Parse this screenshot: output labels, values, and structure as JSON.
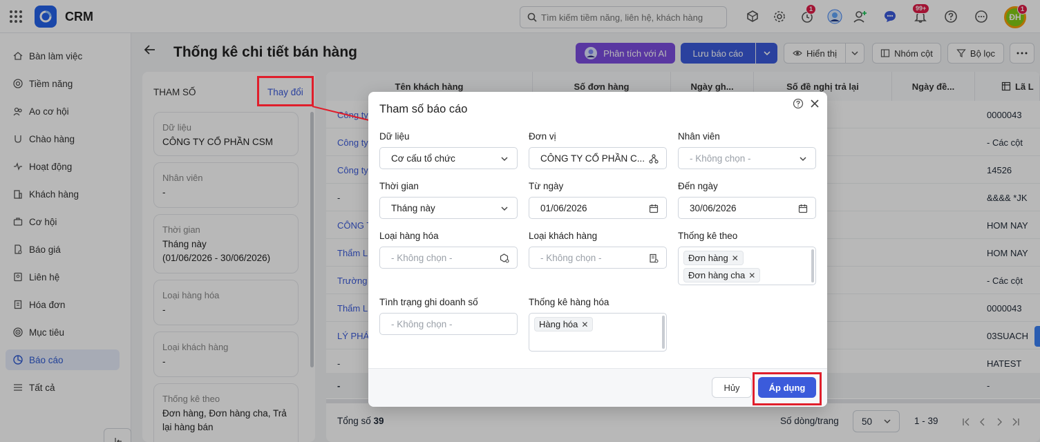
{
  "app": {
    "title": "CRM"
  },
  "search": {
    "placeholder": "Tìm kiếm tiềm năng, liên hệ, khách hàng"
  },
  "header_badges": {
    "timer": "1",
    "notifications": "99+",
    "avatar": "1"
  },
  "avatar_text": "ĐH",
  "sidebar": {
    "items": [
      {
        "label": "Bàn làm việc",
        "icon": "home-icon"
      },
      {
        "label": "Tiềm năng",
        "icon": "target-icon"
      },
      {
        "label": "Ao cơ hội",
        "icon": "people-icon"
      },
      {
        "label": "Chào hàng",
        "icon": "magnet-icon"
      },
      {
        "label": "Hoạt động",
        "icon": "activity-icon"
      },
      {
        "label": "Khách hàng",
        "icon": "building-icon"
      },
      {
        "label": "Cơ hội",
        "icon": "briefcase-icon"
      },
      {
        "label": "Báo giá",
        "icon": "quote-icon"
      },
      {
        "label": "Liên hệ",
        "icon": "contact-icon"
      },
      {
        "label": "Hóa đơn",
        "icon": "invoice-icon"
      },
      {
        "label": "Mục tiêu",
        "icon": "goal-icon"
      },
      {
        "label": "Báo cáo",
        "icon": "report-icon"
      },
      {
        "label": "Tất cả",
        "icon": "menu-icon"
      }
    ]
  },
  "page": {
    "title": "Thống kê chi tiết bán hàng",
    "ai_button": "Phân tích với AI",
    "save_button": "Lưu báo cáo",
    "display_button": "Hiển thị",
    "group_button": "Nhóm cột",
    "filter_button": "Bộ lọc"
  },
  "params": {
    "title": "THAM SỐ",
    "change_link": "Thay đổi",
    "cards": [
      {
        "label": "Dữ liệu",
        "value": "CÔNG TY CỔ PHẦN CSM"
      },
      {
        "label": "Nhân viên",
        "value": "-"
      },
      {
        "label": "Thời gian",
        "value": "Tháng này\n(01/06/2026 - 30/06/2026)"
      },
      {
        "label": "Loại hàng hóa",
        "value": "-"
      },
      {
        "label": "Loại khách hàng",
        "value": "-"
      },
      {
        "label": "Thống kê theo",
        "value": "Đơn hàng, Đơn hàng cha, Trả lại hàng bán"
      }
    ]
  },
  "table": {
    "headers": [
      "Tên khách hàng",
      "Số đơn hàng",
      "Ngày gh...",
      "Số đề nghị trả lại",
      "Ngày đề...",
      "Lã L"
    ],
    "rows": [
      {
        "name": "Công ty",
        "last": "0000043"
      },
      {
        "name": "Công ty",
        "last": "- Các cột"
      },
      {
        "name": "Công ty",
        "last": "14526"
      },
      {
        "name": "-",
        "last": "&&&& *JK"
      },
      {
        "name": "CÔNG T",
        "last": "HOM NAY"
      },
      {
        "name": "Thẩm L",
        "last": "HOM NAY"
      },
      {
        "name": "Trường",
        "last": "- Các cột"
      },
      {
        "name": "Thẩm L",
        "last": "0000043"
      },
      {
        "name": "LÝ PHÁ",
        "last": "03SUACH"
      },
      {
        "name": "-",
        "last": "HATEST"
      },
      {
        "name": "-",
        "last": "-"
      }
    ],
    "total_label": "Tổng số",
    "total_value": "39",
    "rows_per_page_label": "Số dòng/trang",
    "rows_per_page": "50",
    "range": "1 - 39"
  },
  "dialog": {
    "title": "Tham số báo cáo",
    "fields": {
      "data": {
        "label": "Dữ liệu",
        "value": "Cơ cấu tổ chức"
      },
      "unit": {
        "label": "Đơn vị",
        "value": "CÔNG TY CỔ PHẦN C..."
      },
      "employee": {
        "label": "Nhân viên",
        "placeholder": "- Không chọn -"
      },
      "time": {
        "label": "Thời gian",
        "value": "Tháng này"
      },
      "from": {
        "label": "Từ ngày",
        "value": "01/06/2026"
      },
      "to": {
        "label": "Đến ngày",
        "value": "30/06/2026"
      },
      "product_type": {
        "label": "Loại hàng hóa",
        "placeholder": "- Không chọn -"
      },
      "customer_type": {
        "label": "Loại khách hàng",
        "placeholder": "- Không chọn -"
      },
      "stat_by": {
        "label": "Thống kê theo",
        "tags": [
          "Đơn hàng",
          "Đơn hàng cha"
        ]
      },
      "revenue_status": {
        "label": "Tình trạng ghi doanh số",
        "placeholder": "- Không chọn -"
      },
      "stat_product": {
        "label": "Thống kê hàng hóa",
        "tags": [
          "Hàng hóa"
        ]
      }
    },
    "cancel": "Hủy",
    "apply": "Áp dụng"
  },
  "colors": {
    "primary": "#3b5bdb",
    "accent_purple": "#7c3aed",
    "highlight": "#e01e2b"
  }
}
